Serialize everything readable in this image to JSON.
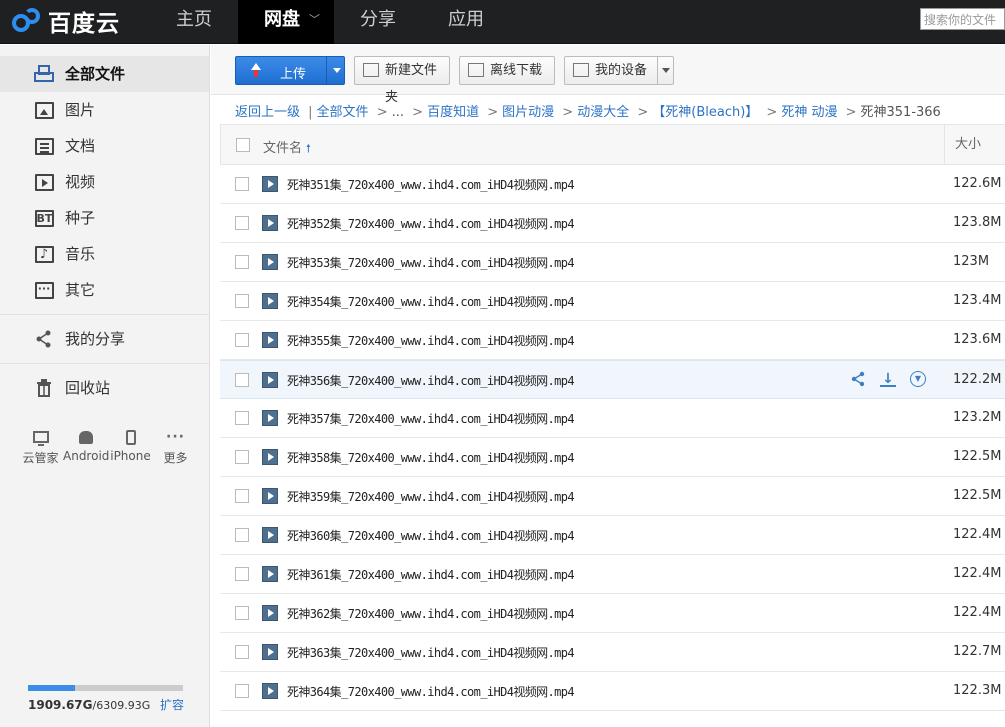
{
  "header": {
    "logo_text": "百度云",
    "nav": [
      {
        "label": "主页",
        "active": false
      },
      {
        "label": "网盘",
        "active": true
      },
      {
        "label": "分享",
        "active": false
      },
      {
        "label": "应用",
        "active": false
      }
    ],
    "search_placeholder": "搜索你的文件"
  },
  "sidebar": {
    "items": [
      {
        "label": "全部文件",
        "icon": "printer-icon",
        "active": true
      },
      {
        "label": "图片",
        "icon": "picture-icon"
      },
      {
        "label": "文档",
        "icon": "document-icon"
      },
      {
        "label": "视频",
        "icon": "video-icon"
      },
      {
        "label": "种子",
        "icon": "bt-icon"
      },
      {
        "label": "音乐",
        "icon": "music-icon"
      },
      {
        "label": "其它",
        "icon": "more-icon"
      }
    ],
    "share_label": "我的分享",
    "recycle_label": "回收站",
    "devices": [
      {
        "label": "云管家",
        "icon": "monitor-icon"
      },
      {
        "label": "Android",
        "icon": "android-icon"
      },
      {
        "label": "iPhone",
        "icon": "iphone-icon"
      },
      {
        "label": "更多",
        "icon": "ellipsis-icon"
      }
    ],
    "quota": {
      "used": "1909.67G",
      "total": "/6309.93G",
      "expand": "扩容",
      "fraction": 0.3
    }
  },
  "toolbar": {
    "upload": "上传",
    "new_folder": "新建文件夹",
    "offline_download": "离线下载",
    "my_devices": "我的设备"
  },
  "breadcrumb": {
    "back": "返回上一级",
    "divider": "|",
    "items": [
      "全部文件",
      "...",
      "百度知道",
      "图片动漫",
      "动漫大全",
      "【死神(Bleach)】",
      "死神 动漫"
    ],
    "current": "死神351-366"
  },
  "list": {
    "col_name": "文件名",
    "col_size": "大小",
    "files": [
      {
        "name": "死神351集_720x400_www.ihd4.com_iHD4视频网.mp4",
        "size": "122.6M"
      },
      {
        "name": "死神352集_720x400_www.ihd4.com_iHD4视频网.mp4",
        "size": "123.8M"
      },
      {
        "name": "死神353集_720x400_www.ihd4.com_iHD4视频网.mp4",
        "size": "123M"
      },
      {
        "name": "死神354集_720x400_www.ihd4.com_iHD4视频网.mp4",
        "size": "123.4M"
      },
      {
        "name": "死神355集_720x400_www.ihd4.com_iHD4视频网.mp4",
        "size": "123.6M"
      },
      {
        "name": "死神356集_720x400_www.ihd4.com_iHD4视频网.mp4",
        "size": "122.2M"
      },
      {
        "name": "死神357集_720x400_www.ihd4.com_iHD4视频网.mp4",
        "size": "123.2M"
      },
      {
        "name": "死神358集_720x400_www.ihd4.com_iHD4视频网.mp4",
        "size": "122.5M"
      },
      {
        "name": "死神359集_720x400_www.ihd4.com_iHD4视频网.mp4",
        "size": "122.5M"
      },
      {
        "name": "死神360集_720x400_www.ihd4.com_iHD4视频网.mp4",
        "size": "122.4M"
      },
      {
        "name": "死神361集_720x400_www.ihd4.com_iHD4视频网.mp4",
        "size": "122.4M"
      },
      {
        "name": "死神362集_720x400_www.ihd4.com_iHD4视频网.mp4",
        "size": "122.4M"
      },
      {
        "name": "死神363集_720x400_www.ihd4.com_iHD4视频网.mp4",
        "size": "122.7M"
      },
      {
        "name": "死神364集_720x400_www.ihd4.com_iHD4视频网.mp4",
        "size": "122.3M"
      }
    ]
  }
}
